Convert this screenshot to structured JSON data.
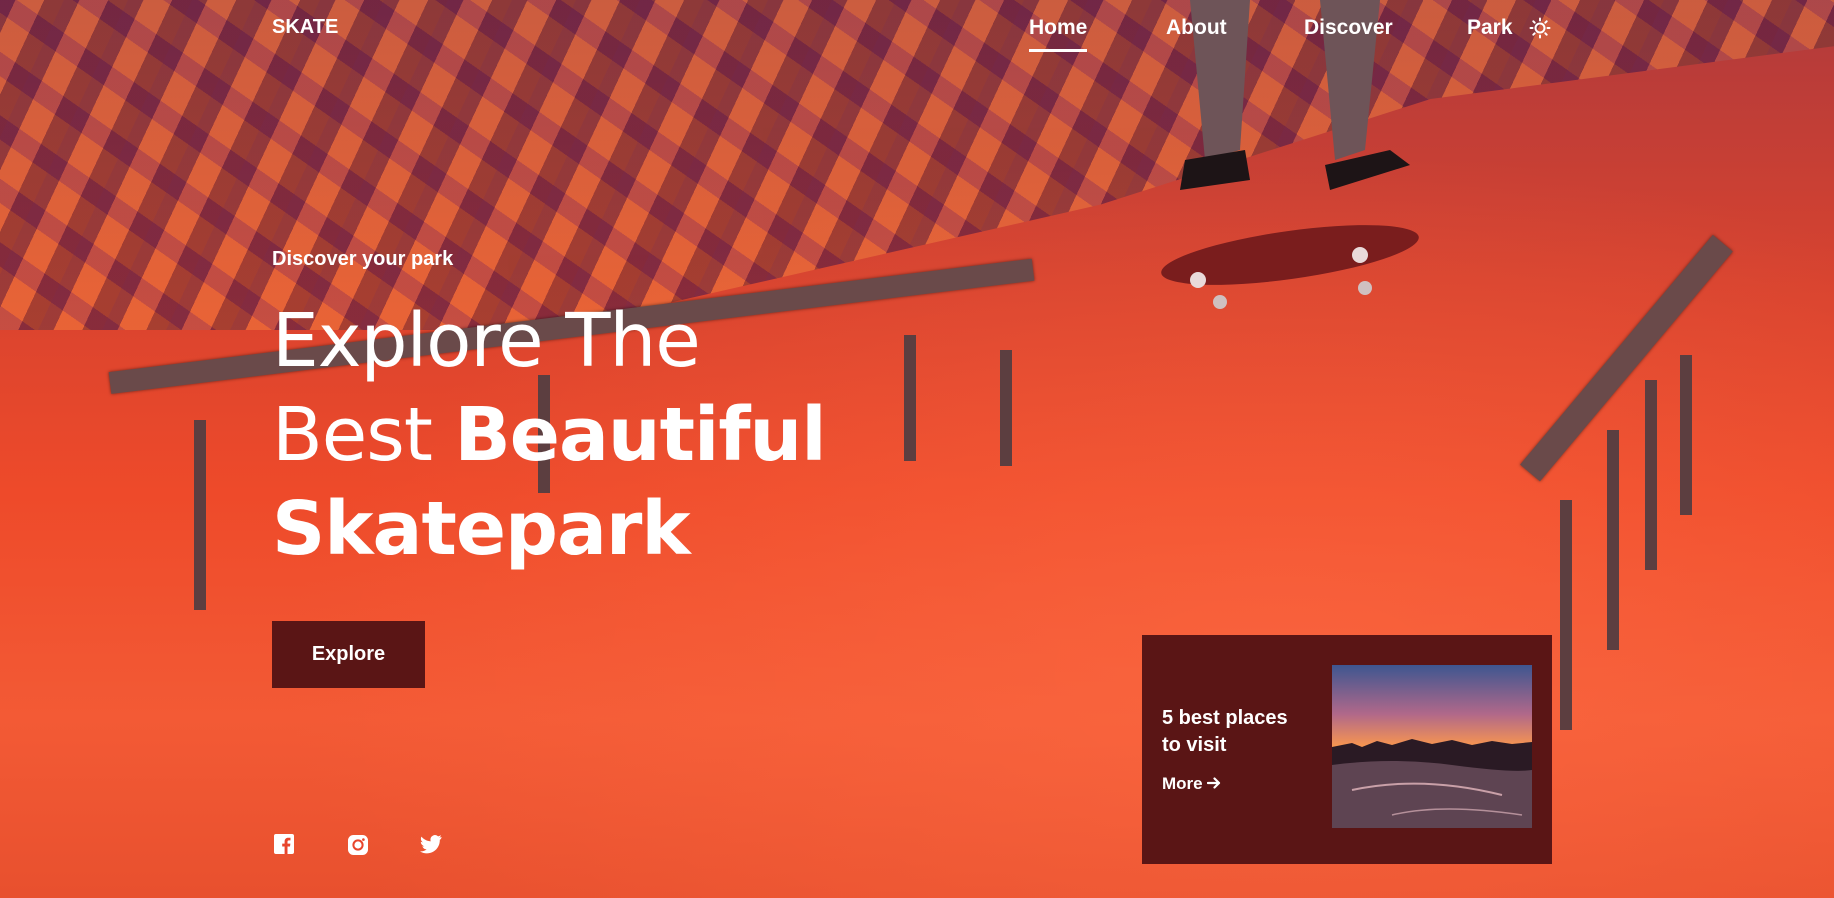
{
  "nav": {
    "brand": "SKATE",
    "links": [
      {
        "label": "Home",
        "active": true
      },
      {
        "label": "About",
        "active": false
      },
      {
        "label": "Discover",
        "active": false
      },
      {
        "label": "Park",
        "active": false
      }
    ],
    "theme_icon": "sun-icon"
  },
  "hero": {
    "eyebrow": "Discover your park",
    "headline_line1": "Explore The",
    "headline_line2_light": "Best ",
    "headline_line2_bold": "Beautiful",
    "headline_line3_bold": "Skatepark",
    "cta_label": "Explore"
  },
  "social": [
    {
      "icon": "facebook-icon"
    },
    {
      "icon": "instagram-icon"
    },
    {
      "icon": "twitter-icon"
    }
  ],
  "card": {
    "title": "5 best places to visit",
    "more_label": "More",
    "more_icon": "arrow-right-icon"
  },
  "colors": {
    "accent_dark": "#5a1515",
    "hero_tint": "#e8452c",
    "text": "#ffffff"
  }
}
